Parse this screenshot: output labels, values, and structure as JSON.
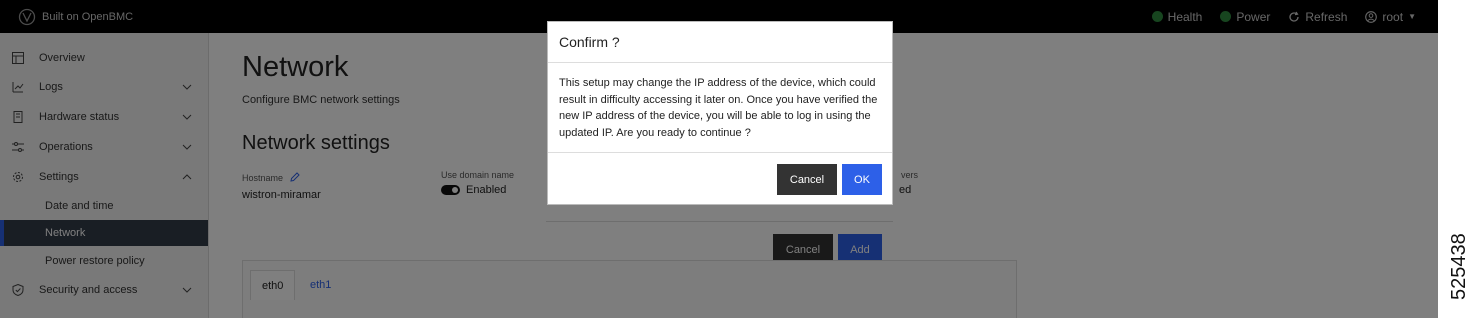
{
  "topbar": {
    "brand": "Built on OpenBMC",
    "health": "Health",
    "power": "Power",
    "refresh": "Refresh",
    "user": "root"
  },
  "sidebar": {
    "items": [
      {
        "label": "Overview",
        "icon": "dashboard-icon"
      },
      {
        "label": "Logs",
        "icon": "logs-icon"
      },
      {
        "label": "Hardware status",
        "icon": "hardware-icon"
      },
      {
        "label": "Operations",
        "icon": "sliders-icon"
      },
      {
        "label": "Settings",
        "icon": "gear-icon"
      },
      {
        "label": "Security and access",
        "icon": "shield-icon"
      }
    ],
    "settings_sub": [
      "Date and time",
      "Network",
      "Power restore policy"
    ],
    "active_sub": "Network"
  },
  "main": {
    "title": "Network",
    "subtitle": "Configure BMC network settings",
    "section": "Network settings",
    "hostname_label": "Hostname",
    "hostname_value": "wistron-miramar",
    "domain_label": "Use domain name",
    "domain_value": "Enabled",
    "servers_label_partial": "vers",
    "servers_value_partial": "ed",
    "tabs": [
      "eth0",
      "eth1"
    ],
    "form_cancel": "Cancel",
    "form_add": "Add"
  },
  "modal": {
    "title": "Confirm ?",
    "body": "This setup may change the IP address of the device, which could result in difficulty accessing it later on. Once you have verified the new IP address of the device, you will be able to log in using the updated IP. Are you ready to continue ?",
    "cancel": "Cancel",
    "ok": "OK"
  },
  "doc_id": "525438",
  "colors": {
    "accent": "#2d60e8",
    "topbar": "#000000",
    "ok": "#2e8b3e",
    "dark_button": "#333333"
  }
}
